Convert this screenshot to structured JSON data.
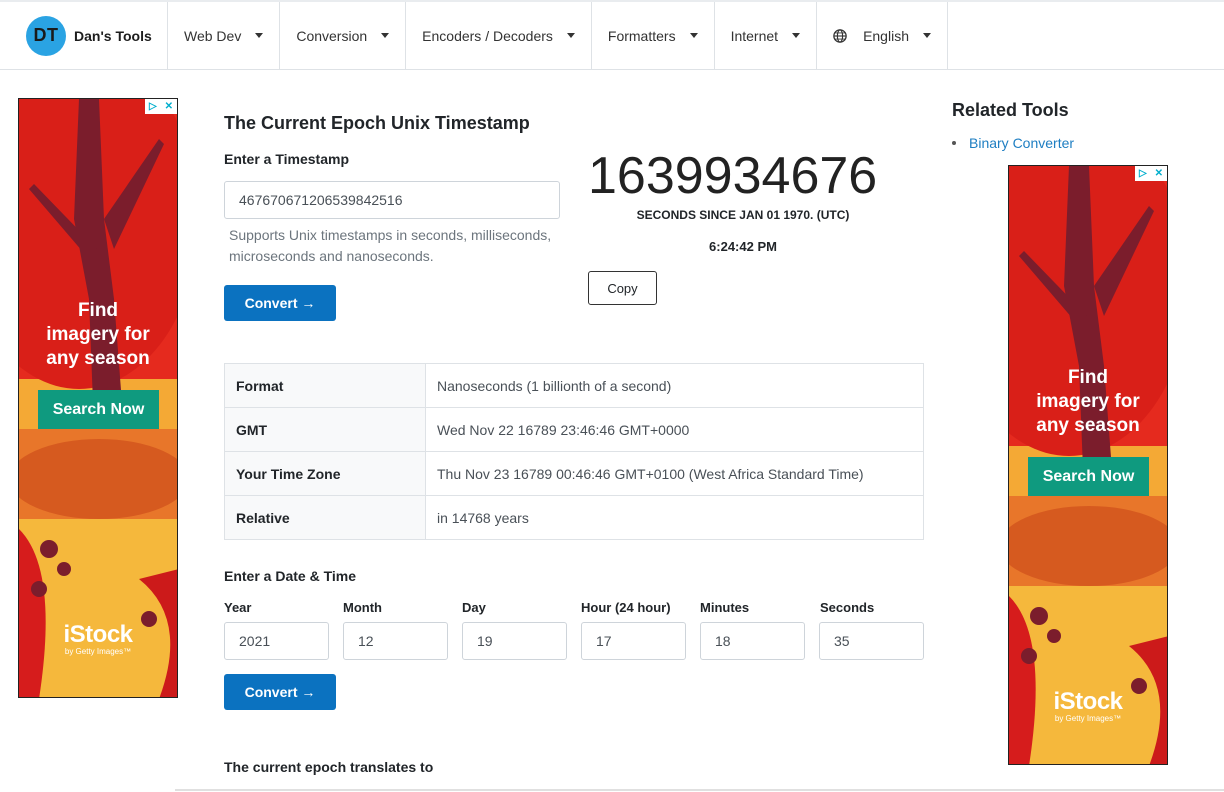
{
  "brand": {
    "logo_text": "DT",
    "name": "Dan's Tools"
  },
  "nav": {
    "items": [
      {
        "label": "Web Dev"
      },
      {
        "label": "Conversion"
      },
      {
        "label": "Encoders / Decoders"
      },
      {
        "label": "Formatters"
      },
      {
        "label": "Internet"
      }
    ],
    "language": "English"
  },
  "ads": {
    "headline": [
      "Find",
      "imagery for",
      "any season"
    ],
    "button": "Search Now",
    "logo": "iStock",
    "logo_sub": "by Getty Images™"
  },
  "main": {
    "title": "The Current Epoch Unix Timestamp",
    "timestamp_label": "Enter a Timestamp",
    "timestamp_value": "467670671206539842516",
    "timestamp_help": "Supports Unix timestamps in seconds, milliseconds, microseconds and nanoseconds.",
    "convert_label": "Convert →",
    "current_epoch": "1639934676",
    "since_label": "SECONDS SINCE JAN 01 1970. (UTC)",
    "current_time": "6:24:42 PM",
    "copy_label": "Copy",
    "result_rows": [
      {
        "key": "Format",
        "value": "Nanoseconds (1 billionth of a second)"
      },
      {
        "key": "GMT",
        "value": "Wed Nov 22 16789 23:46:46 GMT+0000"
      },
      {
        "key": "Your Time Zone",
        "value": "Thu Nov 23 16789 00:46:46 GMT+0100 (West Africa Standard Time)"
      },
      {
        "key": "Relative",
        "value": "in 14768 years"
      }
    ],
    "datetime_label": "Enter a Date & Time",
    "datetime_fields": [
      {
        "label": "Year",
        "value": "2021"
      },
      {
        "label": "Month",
        "value": "12"
      },
      {
        "label": "Day",
        "value": "19"
      },
      {
        "label": "Hour (24 hour)",
        "value": "17"
      },
      {
        "label": "Minutes",
        "value": "18"
      },
      {
        "label": "Seconds",
        "value": "35"
      }
    ],
    "convert2_label": "Convert →",
    "translates_label": "The current epoch translates to"
  },
  "sidebar": {
    "title": "Related Tools",
    "items": [
      {
        "label": "Binary Converter"
      }
    ]
  },
  "colors": {
    "primary": "#0b72c0",
    "brand_circle": "#2aa3e3",
    "link": "#1e7ec2",
    "ad_button": "#0f9a7f"
  }
}
